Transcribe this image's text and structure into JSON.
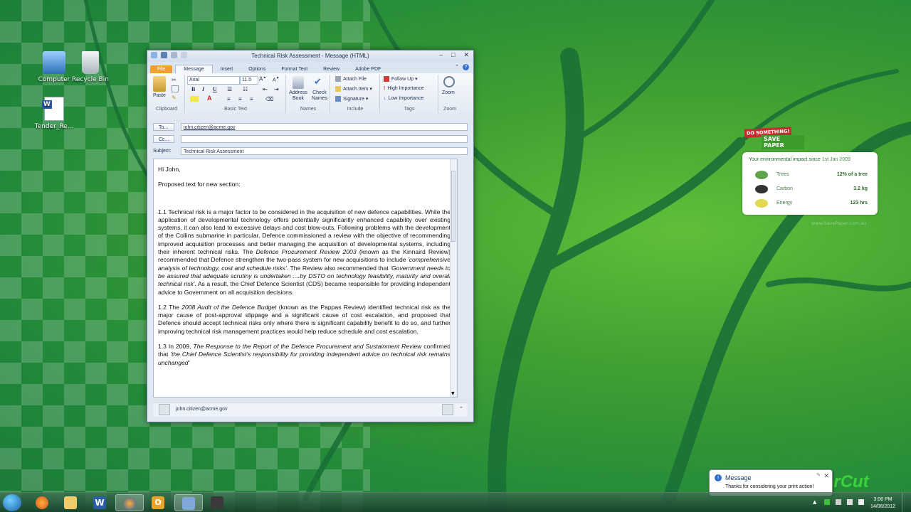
{
  "desktop": {
    "icons": [
      {
        "label": "Computer"
      },
      {
        "label": "Recycle Bin"
      },
      {
        "label": "Tender_Re..."
      }
    ]
  },
  "window": {
    "title": "Technical Risk Assessment - Message (HTML)",
    "tabs": [
      "File",
      "Message",
      "Insert",
      "Options",
      "Format Text",
      "Review",
      "Adobe PDF"
    ],
    "active_tab": "Message",
    "ribbon": {
      "clipboard": {
        "paste": "Paste",
        "group": "Clipboard"
      },
      "basic_text": {
        "font": "Arial",
        "size": "11.5",
        "bold": "B",
        "italic": "I",
        "underline": "U",
        "group": "Basic Text"
      },
      "names": {
        "address_book": "Address Book",
        "check_names": "Check Names",
        "group": "Names"
      },
      "include": {
        "attach_file": "Attach File",
        "attach_item": "Attach Item",
        "signature": "Signature",
        "group": "Include"
      },
      "tags": {
        "follow_up": "Follow Up",
        "high": "High Importance",
        "low": "Low Importance",
        "group": "Tags"
      },
      "zoom": {
        "zoom": "Zoom",
        "group": "Zoom"
      }
    },
    "headers": {
      "to_label": "To...",
      "to_value": "john.citizen@acme.gov",
      "cc_label": "Cc...",
      "cc_value": "",
      "subject_label": "Subject:",
      "subject_value": "Technical Risk Assessment"
    },
    "body": {
      "greeting": "Hi John,",
      "intro": "Proposed text for new section:",
      "p1_a": "1.1 Technical risk is a major factor to be considered in the acquisition of new defence capabilities. While the application of developmental technology offers potentially significantly enhanced capability over existing systems, it can also lead to excessive delays and cost blow-outs. Following problems with the development of the Collins submarine in particular, Defence commissioned a review with the objective of recommending improved acquisition processes and better managing the acquisition of developmental systems, including their inherent technical risks. The ",
      "p1_b": "Defence Procurement Review 2003",
      "p1_c": " (known as the Kinnaird Review) recommended that Defence strengthen the two-pass system for new acquisitions to include ",
      "p1_d": "'comprehensive analysis of technology, cost and schedule risks'",
      "p1_e": ". The Review also recommended that ",
      "p1_f": "'Government needs to be assured that adequate scrutiny is undertaken ....by DSTO on technology feasibility, maturity and overall technical risk'",
      "p1_g": ". As a result, the Chief Defence Scientist (CDS) became responsible for providing independent advice to Government on all acquisition decisions.",
      "p2_a": "1.2 The ",
      "p2_b": "2008 Audit of the Defence Budget",
      "p2_c": " (known as the Pappas Review) identified technical risk as the major cause of post-approval slippage and a significant cause of cost escalation, and proposed that Defence should accept technical risks only where there is significant capability benefit to do so, and further improving technical risk management practices would help reduce schedule and cost escalation.",
      "p3_a": "1.3 In 2009, ",
      "p3_b": "The Response to the Report of the Defence Procurement and Sustainment Review",
      "p3_c": " confirmed that ",
      "p3_d": "'the Chief Defence Scientist's responsibility for providing independent advice on technical risk remains unchanged'"
    },
    "people_pane": {
      "contact": "john.citizen@acme.gov"
    }
  },
  "widget": {
    "badge_top": "DO SOMETHING!",
    "badge_bottom": "SAVE PAPER",
    "header": "Your environmental impact since",
    "since": "1st Jan 2009",
    "rows": [
      {
        "label": "Trees",
        "value": "12% of a tree"
      },
      {
        "label": "Carbon",
        "value": "3.2 kg"
      },
      {
        "label": "Energy",
        "value": "123 hrs"
      }
    ],
    "url": "www.SavePaper.com.au",
    "logo": "erCut"
  },
  "notification": {
    "title": "Message",
    "text": "Thanks for considering your print action!"
  },
  "taskbar": {
    "time": "3:06 PM",
    "date": "14/06/2012"
  },
  "colors": {
    "file_tab": "#f0a030",
    "accent": "#3a73c9",
    "desktop": "#3fa032"
  }
}
